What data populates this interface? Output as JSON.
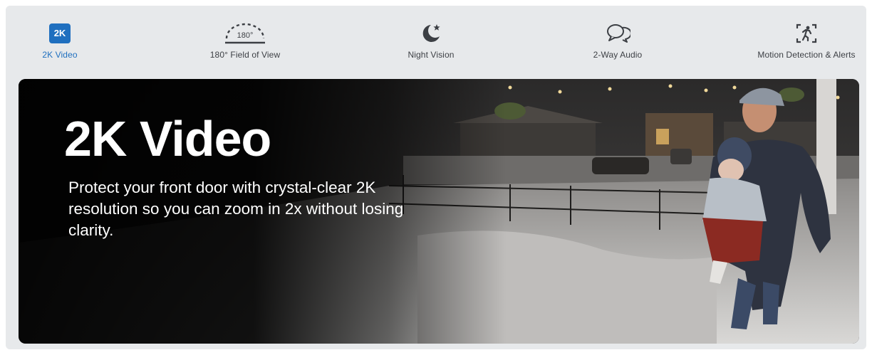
{
  "tabs": [
    {
      "label": "2K Video",
      "icon": "2k-badge-icon",
      "badge_text": "2K",
      "active": true
    },
    {
      "label": "180° Field of View",
      "icon": "field-of-view-icon",
      "badge_text": "180°",
      "active": false
    },
    {
      "label": "Night Vision",
      "icon": "moon-star-icon",
      "active": false
    },
    {
      "label": "2-Way Audio",
      "icon": "chat-bubbles-icon",
      "active": false
    },
    {
      "label": "Motion Detection & Alerts",
      "icon": "motion-person-icon",
      "active": false
    }
  ],
  "hero": {
    "title": "2K Video",
    "description": "Protect your front door with crystal-clear 2K resolution so you can zoom in 2x without losing clarity."
  },
  "colors": {
    "accent": "#1f6fbf",
    "panel_bg": "#e7e9eb",
    "tab_text": "#3c3f44",
    "hero_text": "#ffffff"
  }
}
